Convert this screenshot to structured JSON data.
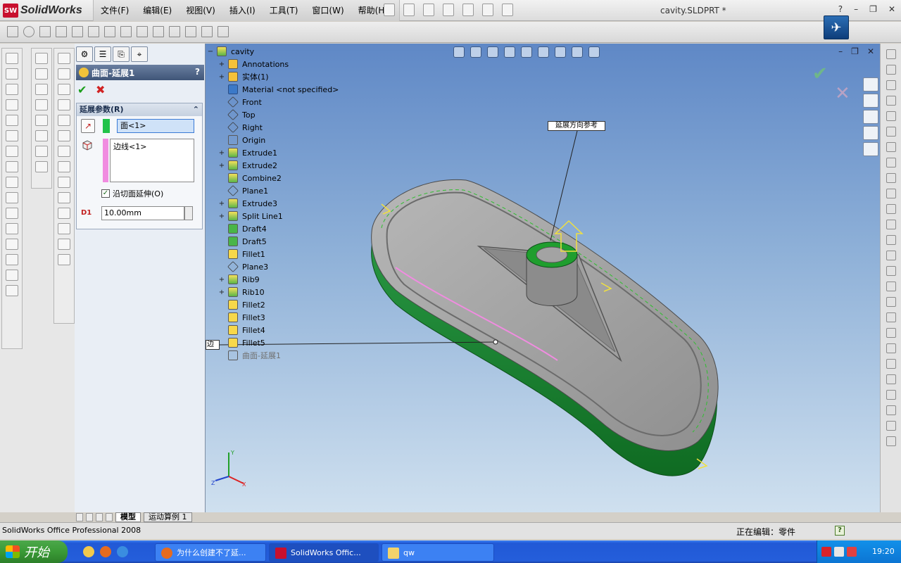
{
  "app": {
    "brand_mark": "SW",
    "brand_name": "SolidWorks",
    "document_title": "cavity.SLDPRT *"
  },
  "menu": {
    "items": [
      "文件(F)",
      "编辑(E)",
      "视图(V)",
      "插入(I)",
      "工具(T)",
      "窗口(W)",
      "帮助(H)"
    ]
  },
  "window": {
    "help": "?",
    "minimize": "–",
    "restore": "❐",
    "close": "✕"
  },
  "property_manager": {
    "title": "曲面-延展1",
    "help": "?",
    "ok": "✔",
    "cancel": "✖",
    "group_title": "延展参数(R)",
    "collapse": "⌃",
    "faces_value": "面<1>",
    "edges_value": "边线<1>",
    "tangent_checkbox": {
      "label": "沿切面延伸(O)",
      "checked": true,
      "mark": "✓"
    },
    "distance_icon_label": "D1",
    "distance_value": "10.00mm"
  },
  "bottom_tabs": {
    "model": "模型",
    "motion": "运动算例 1"
  },
  "feature_tree": {
    "root": "cavity",
    "items": [
      {
        "label": "Annotations",
        "expand": "+",
        "icon": "ann"
      },
      {
        "label": "实体(1)",
        "expand": "+",
        "icon": "ann"
      },
      {
        "label": "Material <not specified>",
        "expand": "",
        "icon": "mat"
      },
      {
        "label": "Front",
        "expand": "",
        "icon": "plane"
      },
      {
        "label": "Top",
        "expand": "",
        "icon": "plane"
      },
      {
        "label": "Right",
        "expand": "",
        "icon": "plane"
      },
      {
        "label": "Origin",
        "expand": "",
        "icon": "origin"
      },
      {
        "label": "Extrude1",
        "expand": "+",
        "icon": "feat"
      },
      {
        "label": "Extrude2",
        "expand": "+",
        "icon": "feat"
      },
      {
        "label": "Combine2",
        "expand": "",
        "icon": "feat"
      },
      {
        "label": "Plane1",
        "expand": "",
        "icon": "plane"
      },
      {
        "label": "Extrude3",
        "expand": "+",
        "icon": "feat"
      },
      {
        "label": "Split Line1",
        "expand": "+",
        "icon": "feat"
      },
      {
        "label": "Draft4",
        "expand": "",
        "icon": "draft"
      },
      {
        "label": "Draft5",
        "expand": "",
        "icon": "draft"
      },
      {
        "label": "Fillet1",
        "expand": "",
        "icon": "fill"
      },
      {
        "label": "Plane3",
        "expand": "",
        "icon": "plane"
      },
      {
        "label": "Rib9",
        "expand": "+",
        "icon": "feat"
      },
      {
        "label": "Rib10",
        "expand": "+",
        "icon": "feat"
      },
      {
        "label": "Fillet2",
        "expand": "",
        "icon": "fill"
      },
      {
        "label": "Fillet3",
        "expand": "",
        "icon": "fill"
      },
      {
        "label": "Fillet4",
        "expand": "",
        "icon": "fill"
      },
      {
        "label": "Fillet5",
        "expand": "",
        "icon": "fill"
      },
      {
        "label": "曲面-延展1",
        "expand": "",
        "icon": "surface",
        "faded": true
      }
    ]
  },
  "viewport": {
    "callout_direction": "延展方向参考",
    "left_callout": "边",
    "ok": "✔",
    "cancel": "✕",
    "triad": {
      "x": "X",
      "y": "Y",
      "z": "Z"
    }
  },
  "status": {
    "left": "SolidWorks Office Professional 2008",
    "right": "正在编辑：零件",
    "help": "?"
  },
  "taskbar": {
    "start": "开始",
    "buttons": [
      {
        "label": "为什么创建不了延...",
        "active": false
      },
      {
        "label": "SolidWorks Offic...",
        "active": true
      },
      {
        "label": "qw",
        "active": false
      }
    ],
    "clock": "19:20"
  },
  "colors": {
    "viewport_top": "#5f88c6",
    "model_body": "#9b9b9b",
    "edge_green": "#1e8f2e",
    "selection_pink": "#f08ce0"
  }
}
